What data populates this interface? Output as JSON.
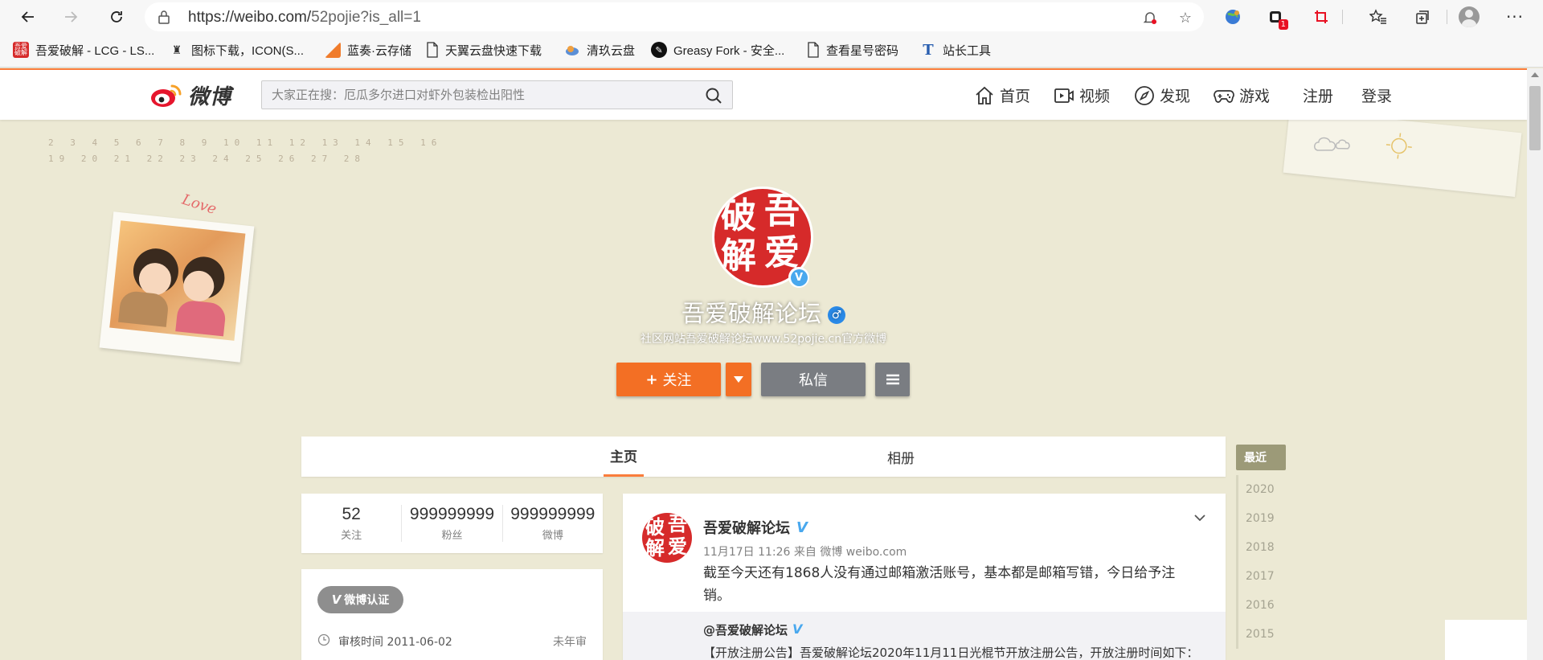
{
  "browser": {
    "url_main": "https://weibo.com/",
    "url_path": "52pojie?is_all=1",
    "bookmarks": [
      {
        "label": "吾爱破解 - LCG - LS..."
      },
      {
        "label": "图标下载，ICON(S..."
      },
      {
        "label": "蓝奏·云存储"
      },
      {
        "label": "天翼云盘快速下载"
      },
      {
        "label": "清玖云盘"
      },
      {
        "label": "Greasy Fork - 安全..."
      },
      {
        "label": "查看星号密码"
      },
      {
        "label": "站长工具"
      }
    ],
    "extension_badge": "1"
  },
  "header": {
    "logo_text": "微博",
    "search_placeholder": "大家正在搜：厄瓜多尔进口对虾外包装检出阳性",
    "nav": {
      "home": "首页",
      "video": "视频",
      "discover": "发现",
      "game": "游戏",
      "register": "注册",
      "login": "登录"
    }
  },
  "decor": {
    "calendar_row1": "2 3 4 5 6 7 8 9 10 11 12 13 14 15 16",
    "calendar_row2": "19 20 21 22 23 24 25 26 27 28",
    "love_text": "Love"
  },
  "profile": {
    "avatar_chars": [
      "吾",
      "爱",
      "破",
      "解"
    ],
    "verified_mark": "V",
    "name": "吾爱破解论坛",
    "gender_symbol": "♂",
    "description": "社区网站吾爱破解论坛www.52pojie.cn官方微博",
    "follow_label": "关注",
    "message_label": "私信"
  },
  "tabs": {
    "home": "主页",
    "album": "相册"
  },
  "stats": [
    {
      "value": "52",
      "label": "关注"
    },
    {
      "value": "999999999",
      "label": "粉丝"
    },
    {
      "value": "999999999",
      "label": "微博"
    }
  ],
  "cert": {
    "badge_label": "微博认证",
    "review_label": "审核时间 2011-06-02",
    "review_value": "未年审"
  },
  "feed": {
    "author": "吾爱破解论坛",
    "meta": "11月17日 11:26 来自 微博 weibo.com",
    "text": "截至今天还有1868人没有通过邮箱激活账号，基本都是邮箱写错，今日给予注销。",
    "repost_author": "@吾爱破解论坛",
    "repost_text": "【开放注册公告】吾爱破解论坛2020年11月11日光棍节开放注册公告，开放注册时间如下："
  },
  "years": {
    "active": "最近",
    "list": [
      "2020",
      "2019",
      "2018",
      "2017",
      "2016",
      "2015"
    ]
  },
  "colors": {
    "accent": "#fa7d3c",
    "follow_button": "#f36f24",
    "secondary_button": "#7a7d82",
    "seal_red": "#d62a2a",
    "verified_blue": "#49a8ee",
    "page_bg": "#ece9d4"
  }
}
